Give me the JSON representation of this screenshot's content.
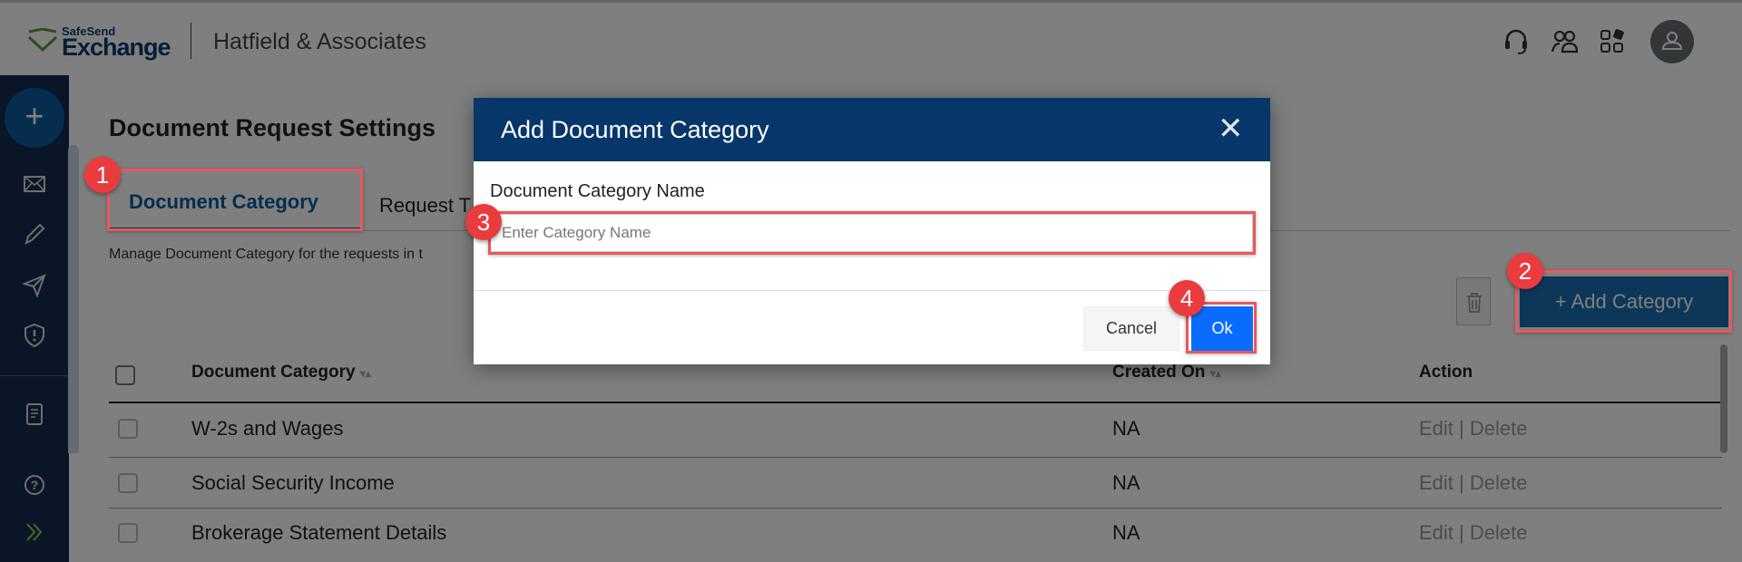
{
  "header": {
    "logo_small": "SafeSend",
    "logo_big": "Exchange",
    "company": "Hatfield & Associates",
    "icons": [
      "headset-icon",
      "users-icon",
      "apps-icon",
      "avatar-icon"
    ]
  },
  "sidebar": {
    "icons": [
      "plus-icon",
      "mail-icon",
      "pencil-icon",
      "send-icon",
      "shield-alert-icon",
      "document-icon",
      "help-icon",
      "expand-chevrons-icon"
    ]
  },
  "page": {
    "title": "Document Request Settings",
    "tabs": [
      {
        "label": "Document Category",
        "active": true
      },
      {
        "label": "Request T"
      }
    ],
    "description": "Manage Document Category for the requests in t",
    "add_button": "+ Add Category",
    "table": {
      "headers": [
        "Document Category",
        "Created On",
        "Action"
      ],
      "rows": [
        {
          "category": "W-2s and Wages",
          "created_on": "NA",
          "action": "Edit | Delete"
        },
        {
          "category": "Social Security Income",
          "created_on": "NA",
          "action": "Edit | Delete"
        },
        {
          "category": "Brokerage Statement Details",
          "created_on": "NA",
          "action": "Edit | Delete"
        }
      ]
    }
  },
  "modal": {
    "title": "Add Document Category",
    "label": "Document Category Name",
    "input_value": "",
    "placeholder": "Enter Category Name",
    "cancel": "Cancel",
    "ok": "Ok"
  },
  "annotations": [
    "1",
    "2",
    "3",
    "4"
  ],
  "colors": {
    "modal_header": "#06366a",
    "ok_button": "#0a6cff",
    "annotation": "#ea3b3f",
    "sidebar": "#142c50"
  }
}
